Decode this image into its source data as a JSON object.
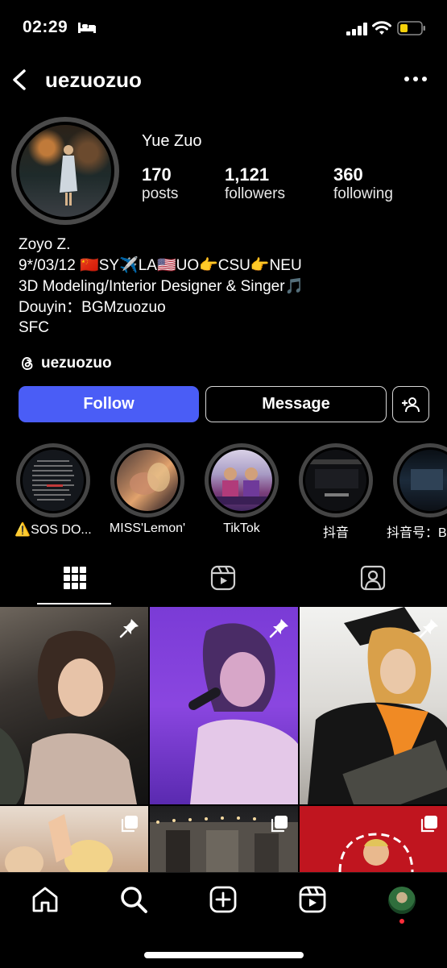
{
  "status_bar": {
    "time": "02:29"
  },
  "header": {
    "username": "uezuozuo"
  },
  "profile": {
    "display_name": "Yue Zuo",
    "stats": [
      {
        "value": "170",
        "label": "posts"
      },
      {
        "value": "1,121",
        "label": "followers"
      },
      {
        "value": "360",
        "label": "following"
      }
    ],
    "bio": [
      "Zoyo Z.",
      "9*/03/12 🇨🇳SY✈️LA🇺🇸UO👉CSU👉NEU",
      "3D Modeling/Interior Designer & Singer🎵",
      "Douyin：BGMzuozuo",
      "SFC"
    ],
    "threads_handle": "uezuozuo"
  },
  "actions": {
    "follow_label": "Follow",
    "message_label": "Message"
  },
  "highlights": [
    {
      "label": "⚠️SOS DO..."
    },
    {
      "label": "MISS'Lemon'"
    },
    {
      "label": "TikTok"
    },
    {
      "label": "抖音"
    },
    {
      "label": "抖音号：B"
    }
  ],
  "tabs": [
    "grid",
    "reels",
    "tagged"
  ],
  "grid_tiles": [
    {
      "badge": "pin"
    },
    {
      "badge": "pin"
    },
    {
      "badge": "pin"
    },
    {
      "badge": "multiple"
    },
    {
      "badge": "multiple"
    },
    {
      "badge": "multiple"
    }
  ],
  "bottom_nav": [
    "home",
    "search",
    "create",
    "reels",
    "profile"
  ]
}
